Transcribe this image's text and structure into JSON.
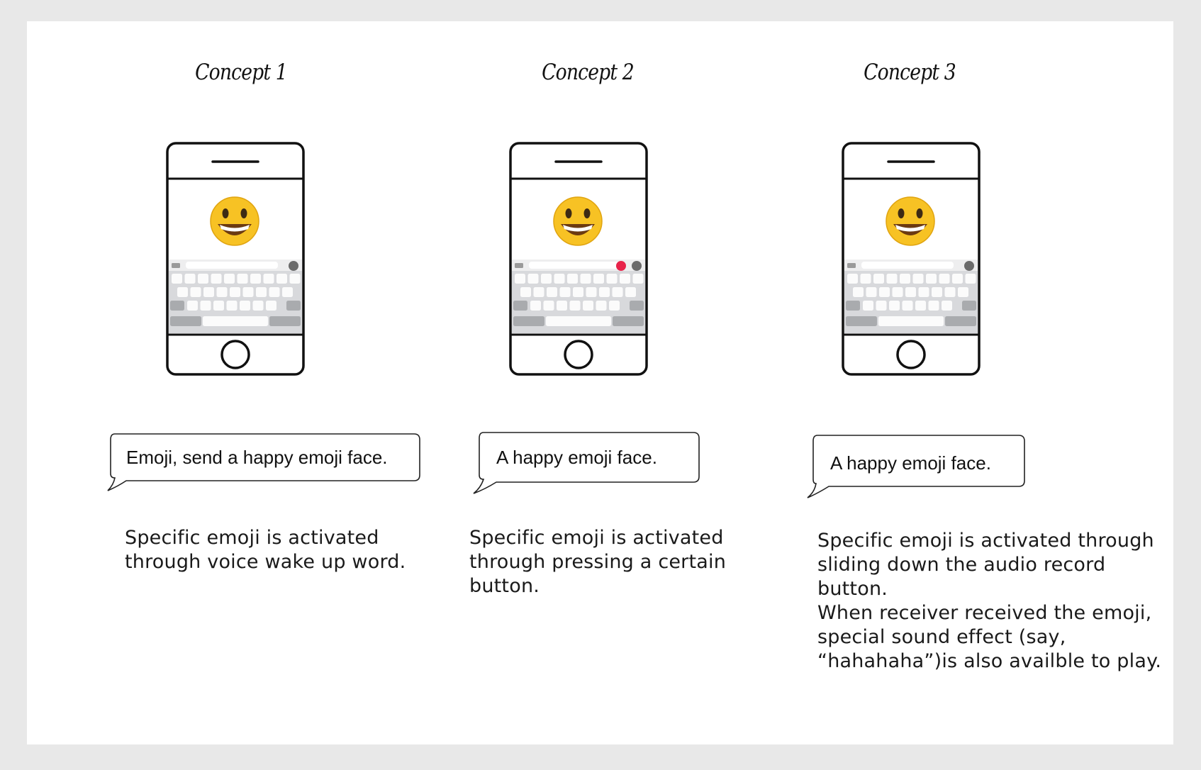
{
  "concepts": [
    {
      "title": "Concept 1",
      "bubble": "Emoji, send a happy emoji face.",
      "description": [
        "Specific emoji is activated",
        "through voice wake up word."
      ],
      "has_red_button": false
    },
    {
      "title": "Concept 2",
      "bubble": "A happy emoji face.",
      "description": [
        "Specific emoji is activated",
        "through pressing a certain",
        "button."
      ],
      "has_red_button": true
    },
    {
      "title": "Concept 3",
      "bubble": "A happy emoji face.",
      "description": [
        "Specific emoji is activated through",
        "sliding down the audio record",
        "button.",
        "When receiver received the emoji,",
        "special sound effect (say,",
        "“hahahaha”)is also availble to play."
      ],
      "has_red_button": false
    }
  ],
  "icons": {
    "emoji": "grinning-face-emoji",
    "camera": "camera-icon",
    "record": "record-button-icon",
    "mic": "audio-button-icon",
    "home": "home-button-icon"
  },
  "colors": {
    "record_red": "#e8234a",
    "audio_gray": "#6b6b6b",
    "emoji_yellow": "#f7c224",
    "keyboard_bg": "#d8d9dc"
  }
}
